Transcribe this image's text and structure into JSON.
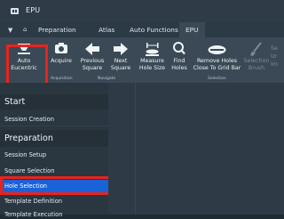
{
  "app": {
    "title": "EPU"
  },
  "menubar": {
    "tabs": [
      {
        "label": "Preparation"
      },
      {
        "label": "Atlas"
      },
      {
        "label": "Auto Functions"
      },
      {
        "label": "EPU"
      }
    ],
    "active_tab": "EPU"
  },
  "ribbon": {
    "buttons": [
      {
        "label": "Auto\nEucentric",
        "icon": "eucentric-icon"
      },
      {
        "label": "Acquire",
        "icon": "camera-icon"
      },
      {
        "label": "Previous\nSquare",
        "icon": "arrow-left-icon"
      },
      {
        "label": "Next\nSquare",
        "icon": "arrow-right-icon"
      },
      {
        "label": "Measure\nHole Size",
        "icon": "measure-icon"
      },
      {
        "label": "Find\nHoles",
        "icon": "magnifier-icon"
      },
      {
        "label": "Remove Holes\nClose To Grid Bar",
        "icon": "remove-holes-icon"
      },
      {
        "label": "Selection\nBrush",
        "icon": "brush-icon"
      }
    ],
    "groups": [
      {
        "label": "Acquisition"
      },
      {
        "label": "Navigate"
      },
      {
        "label": "Selection"
      }
    ],
    "truncated_labels": [
      "Se",
      "Ur",
      "Im"
    ]
  },
  "left_panel": {
    "sections": [
      {
        "title": "Start",
        "items": [
          {
            "label": "Session Creation"
          }
        ]
      },
      {
        "title": "Preparation",
        "items": [
          {
            "label": "Session Setup"
          },
          {
            "label": "Square Selection"
          },
          {
            "label": "Hole Selection",
            "selected": true
          },
          {
            "label": "Template Definition"
          },
          {
            "label": "Template Execution"
          }
        ]
      }
    ]
  },
  "colors": {
    "highlight": "#e8241d",
    "selection": "#1a62d8"
  }
}
